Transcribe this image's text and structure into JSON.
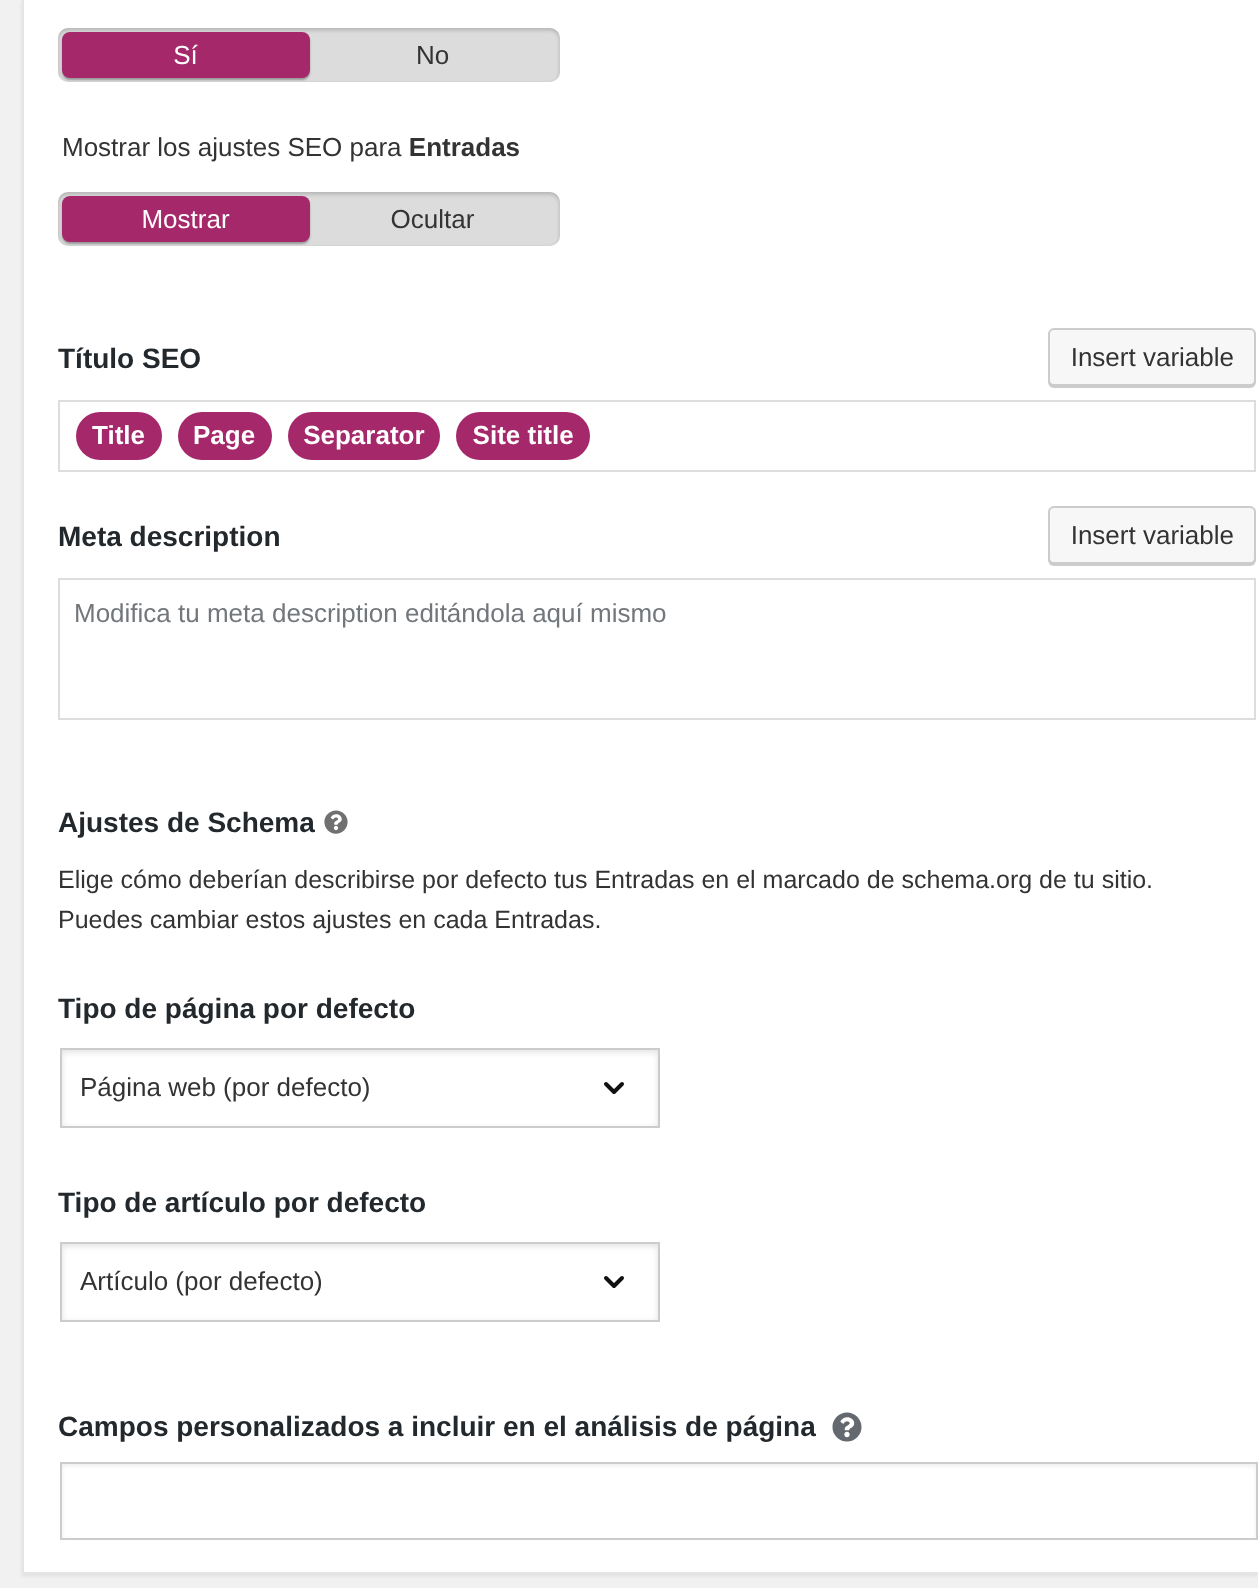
{
  "toggle_1": {
    "options": [
      {
        "label": "Sí",
        "selected": true
      },
      {
        "label": "No",
        "selected": false
      }
    ]
  },
  "show_settings": {
    "label": "Mostrar los ajustes SEO para **Entradas**",
    "options": [
      {
        "label": "Mostrar",
        "selected": true
      },
      {
        "label": "Ocultar",
        "selected": false
      }
    ]
  },
  "seo_title": {
    "label": "Título SEO",
    "button": "Insert variable",
    "tags": [
      "Title",
      "Page",
      "Separator",
      "Site title"
    ]
  },
  "meta_description": {
    "label": "Meta description",
    "button": "Insert variable",
    "placeholder": "Modifica tu meta description editándola aquí mismo"
  },
  "schema": {
    "title": "Ajustes de Schema",
    "description": "Elige cómo deberían describirse por defecto tus Entradas en el marcado de schema.org de tu sitio. Puedes cambiar estos ajustes en cada Entradas."
  },
  "page_type": {
    "label": "Tipo de página por defecto",
    "value": "Página web (por defecto)"
  },
  "article_type": {
    "label": "Tipo de artículo por defecto",
    "value": "Artículo (por defecto)"
  },
  "custom_fields": {
    "label": "Campos personalizados a incluir en el análisis de página"
  }
}
